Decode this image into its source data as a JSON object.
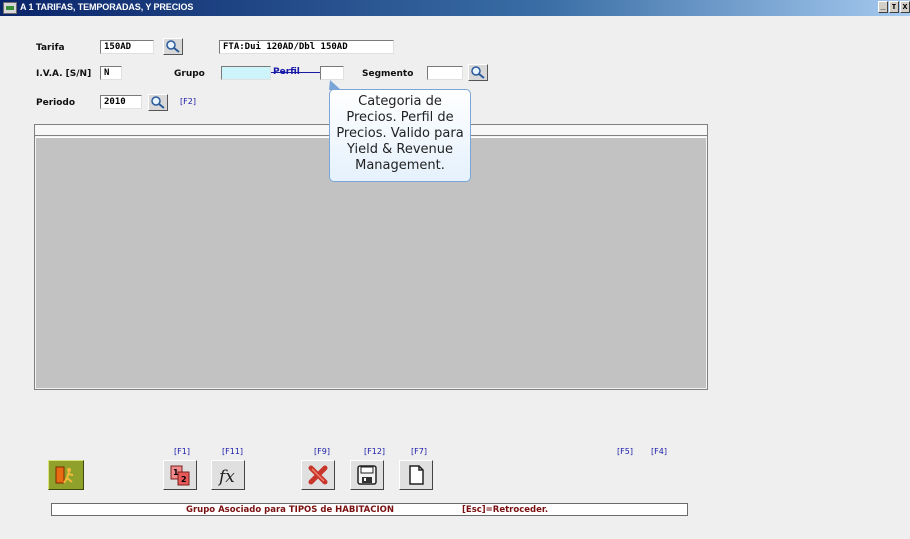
{
  "window": {
    "title": "A 1  TARIFAS, TEMPORADAS, Y PRECIOS",
    "buttons": [
      "_",
      "т",
      "x"
    ]
  },
  "form": {
    "tarifa": {
      "label": "Tarifa",
      "value": "150AD"
    },
    "tarifa_desc": {
      "value": "FTA:Dui 120AD/Dbl 150AD"
    },
    "iva": {
      "label": "I.V.A. [S/N]",
      "value": "N"
    },
    "grupo": {
      "label": "Grupo",
      "value": ""
    },
    "perfil": {
      "label": "Perfil",
      "value": ""
    },
    "segmento": {
      "label": "Segmento",
      "value": ""
    },
    "periodo": {
      "label": "Periodo",
      "value": "2010",
      "fkey": "[F2]"
    }
  },
  "tooltip": {
    "lines": [
      "Categoria de",
      "Precios. Perfil de",
      "Precios. Valido para",
      "Yield & Revenue",
      "Management."
    ]
  },
  "toolbar": {
    "fkeys": {
      "f1": "[F1]",
      "f11": "[F11]",
      "f9": "[F9]",
      "f12": "[F12]",
      "f7": "[F7]",
      "f5": "[F5]",
      "f4": "[F4]"
    }
  },
  "status": {
    "message": "Grupo Asociado para TIPOS de HABITACION",
    "esc": "[Esc]=Retroceder."
  },
  "colors": {
    "title_bar": "#0a246a",
    "teal_field": "#cdf3fb",
    "fkey_blue": "#1a1aa8",
    "status_text": "#7a1010",
    "grid": "#c2c2c2"
  }
}
